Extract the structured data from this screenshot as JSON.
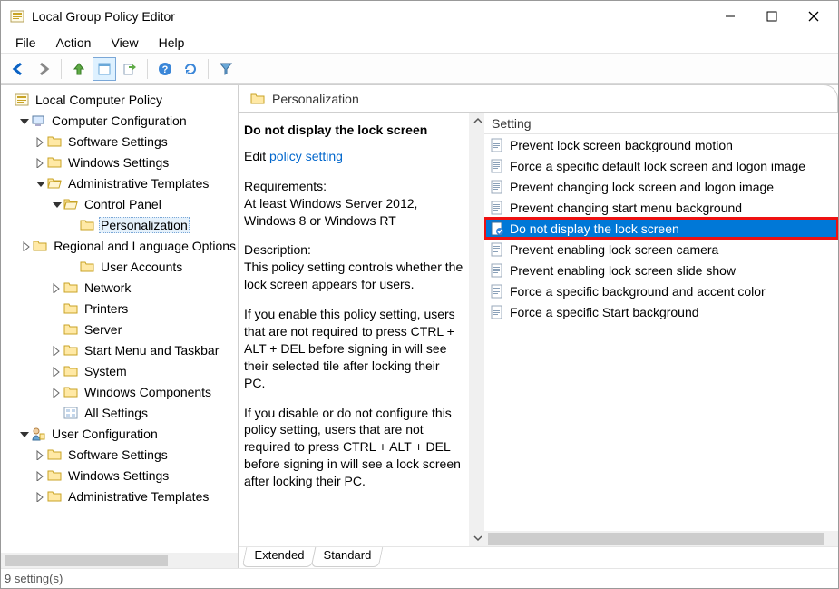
{
  "window": {
    "title": "Local Group Policy Editor"
  },
  "menu": {
    "file": "File",
    "action": "Action",
    "view": "View",
    "help": "Help"
  },
  "tree": {
    "n0": "Local Computer Policy",
    "n1": "Computer Configuration",
    "n2": "Software Settings",
    "n3": "Windows Settings",
    "n4": "Administrative Templates",
    "n5": "Control Panel",
    "n6": "Personalization",
    "n7": "Regional and Language Options",
    "n8": "User Accounts",
    "n9": "Network",
    "n10": "Printers",
    "n11": "Server",
    "n12": "Start Menu and Taskbar",
    "n13": "System",
    "n14": "Windows Components",
    "n15": "All Settings",
    "n16": "User Configuration",
    "n17": "Software Settings",
    "n18": "Windows Settings",
    "n19": "Administrative Templates"
  },
  "header": {
    "title": "Personalization"
  },
  "detail": {
    "title": "Do not display the lock screen",
    "edit_prefix": "Edit ",
    "edit_link": "policy setting ",
    "req_label": "Requirements:",
    "req_text": "At least Windows Server 2012, Windows 8 or Windows RT",
    "desc_label": "Description:",
    "desc_p1": "This policy setting controls whether the lock screen appears for users.",
    "desc_p2": "If you enable this policy setting, users that are not required to press CTRL + ALT + DEL before signing in will see their selected tile after locking their PC.",
    "desc_p3": "If you disable or do not configure this policy setting, users that are not required to press CTRL + ALT + DEL before signing in will see a lock screen after locking their PC."
  },
  "list": {
    "header": "Setting",
    "i0": "Prevent lock screen background motion",
    "i1": "Force a specific default lock screen and logon image",
    "i2": "Prevent changing lock screen and logon image",
    "i3": "Prevent changing start menu background",
    "i4": "Do not display the lock screen",
    "i5": "Prevent enabling lock screen camera",
    "i6": "Prevent enabling lock screen slide show",
    "i7": "Force a specific background and accent color",
    "i8": "Force a specific Start background"
  },
  "tabs": {
    "extended": "Extended",
    "standard": "Standard"
  },
  "status": {
    "text": "9 setting(s)"
  }
}
